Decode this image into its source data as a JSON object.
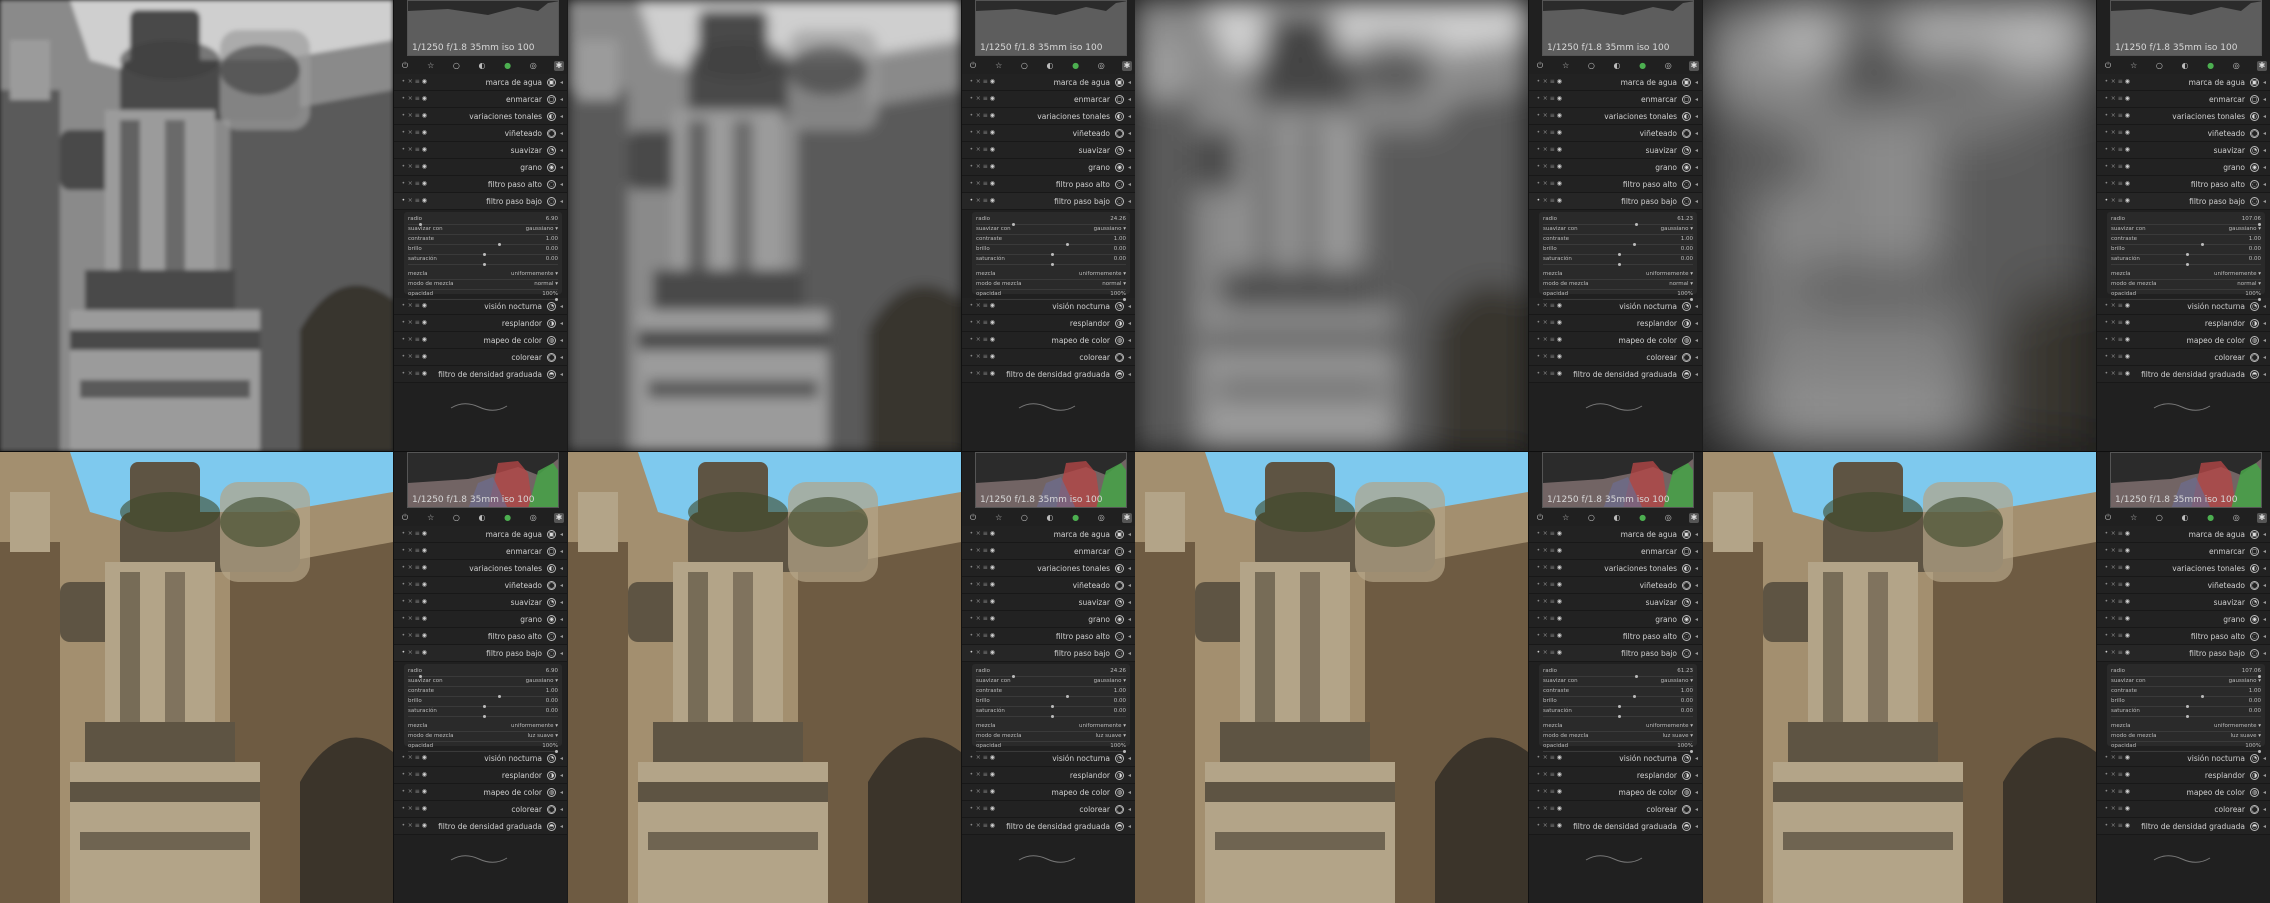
{
  "exif": "1/1250 f/1.8 35mm iso 100",
  "groups": {
    "icons": [
      "power-icon",
      "star-icon",
      "circle-icon",
      "circle-half-icon",
      "color-circle-icon",
      "aperture-icon",
      "gear-icon"
    ]
  },
  "modules_before": [
    {
      "name": "marca de agua",
      "icon": "watermark-icon"
    },
    {
      "name": "enmarcar",
      "icon": "frame-icon"
    },
    {
      "name": "variaciones tonales",
      "icon": "split-tone-icon"
    },
    {
      "name": "viñeteado",
      "icon": "vignette-icon"
    },
    {
      "name": "suavizar",
      "icon": "soften-icon"
    },
    {
      "name": "grano",
      "icon": "grain-icon"
    },
    {
      "name": "filtro paso alto",
      "icon": "highpass-icon"
    },
    {
      "name": "filtro paso bajo",
      "icon": "lowpass-icon"
    }
  ],
  "modules_after": [
    {
      "name": "visión nocturna",
      "icon": "night-vision-icon"
    },
    {
      "name": "resplandor",
      "icon": "bloom-icon"
    },
    {
      "name": "mapeo de color",
      "icon": "color-mapping-icon"
    },
    {
      "name": "colorear",
      "icon": "colorize-icon"
    },
    {
      "name": "filtro de densidad graduada",
      "icon": "graduated-density-icon"
    }
  ],
  "param_labels": {
    "radio": "radio",
    "suavizar_con": "suavizar con",
    "contraste": "contraste",
    "brillo": "brillo",
    "saturacion": "saturación",
    "mezcla": "mezcla",
    "modo_de_mezcla": "modo de mezcla",
    "opacidad": "opacidad"
  },
  "tiles": [
    {
      "row": 0,
      "radio": "6.90",
      "suavizar_con": "gaussiano",
      "contraste": "1.00",
      "brillo": "0.00",
      "saturacion": "0.00",
      "mezcla": "uniformemente",
      "modo": "normal",
      "opacidad": "100%",
      "blur": 2,
      "color": false,
      "radius_fraction": 0.07,
      "contrast_fraction": 0.6,
      "brightness_fraction": 0.5,
      "saturation_fraction": 0.5
    },
    {
      "row": 0,
      "radio": "24.26",
      "suavizar_con": "gaussiano",
      "contraste": "1.00",
      "brillo": "0.00",
      "saturacion": "0.00",
      "mezcla": "uniformemente",
      "modo": "normal",
      "opacidad": "100%",
      "blur": 6,
      "color": false,
      "radius_fraction": 0.24,
      "contrast_fraction": 0.6,
      "brightness_fraction": 0.5,
      "saturation_fraction": 0.5
    },
    {
      "row": 0,
      "radio": "61.23",
      "suavizar_con": "gaussiano",
      "contraste": "1.00",
      "brillo": "0.00",
      "saturacion": "0.00",
      "mezcla": "uniformemente",
      "modo": "normal",
      "opacidad": "100%",
      "blur": 14,
      "color": false,
      "radius_fraction": 0.61,
      "contrast_fraction": 0.6,
      "brightness_fraction": 0.5,
      "saturation_fraction": 0.5
    },
    {
      "row": 0,
      "radio": "107.06",
      "suavizar_con": "gaussiano",
      "contraste": "1.00",
      "brillo": "0.00",
      "saturacion": "0.00",
      "mezcla": "uniformemente",
      "modo": "normal",
      "opacidad": "100%",
      "blur": 26,
      "color": false,
      "radius_fraction": 0.98,
      "contrast_fraction": 0.6,
      "brightness_fraction": 0.5,
      "saturation_fraction": 0.5
    },
    {
      "row": 1,
      "radio": "6.90",
      "suavizar_con": "gaussiano",
      "contraste": "1.00",
      "brillo": "0.00",
      "saturacion": "0.00",
      "mezcla": "uniformemente",
      "modo": "luz suave",
      "opacidad": "100%",
      "blur": 0,
      "color": true,
      "radius_fraction": 0.07,
      "contrast_fraction": 0.6,
      "brightness_fraction": 0.5,
      "saturation_fraction": 0.5
    },
    {
      "row": 1,
      "radio": "24.26",
      "suavizar_con": "gaussiano",
      "contraste": "1.00",
      "brillo": "0.00",
      "saturacion": "0.00",
      "mezcla": "uniformemente",
      "modo": "luz suave",
      "opacidad": "100%",
      "blur": 0,
      "color": true,
      "radius_fraction": 0.24,
      "contrast_fraction": 0.6,
      "brightness_fraction": 0.5,
      "saturation_fraction": 0.5
    },
    {
      "row": 1,
      "radio": "61.23",
      "suavizar_con": "gaussiano",
      "contraste": "1.00",
      "brillo": "0.00",
      "saturacion": "0.00",
      "mezcla": "uniformemente",
      "modo": "luz suave",
      "opacidad": "100%",
      "blur": 0,
      "color": true,
      "radius_fraction": 0.61,
      "contrast_fraction": 0.6,
      "brightness_fraction": 0.5,
      "saturation_fraction": 0.5
    },
    {
      "row": 1,
      "radio": "107.06",
      "suavizar_con": "gaussiano",
      "contraste": "1.00",
      "brillo": "0.00",
      "saturacion": "0.00",
      "mezcla": "uniformemente",
      "modo": "luz suave",
      "opacidad": "100%",
      "blur": 0,
      "color": true,
      "radius_fraction": 0.98,
      "contrast_fraction": 0.6,
      "brightness_fraction": 0.5,
      "saturation_fraction": 0.5
    }
  ]
}
